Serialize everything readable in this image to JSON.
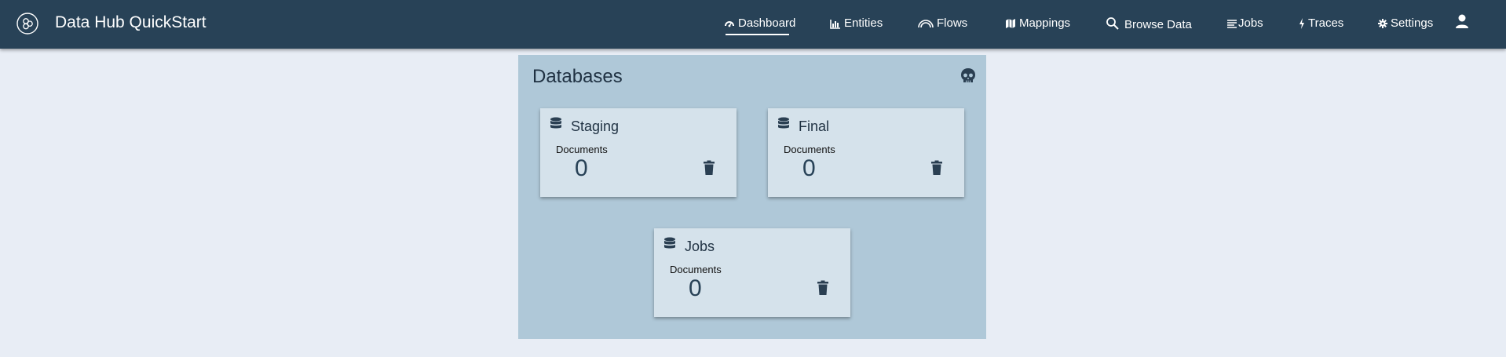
{
  "app": {
    "title": "Data Hub QuickStart"
  },
  "nav": {
    "items": [
      {
        "label": "Dashboard",
        "icon": "dashboard-icon"
      },
      {
        "label": "Entities",
        "icon": "entities-icon"
      },
      {
        "label": "Flows",
        "icon": "flows-icon"
      },
      {
        "label": "Mappings",
        "icon": "map-icon"
      },
      {
        "label": "Browse Data",
        "icon": "search-icon"
      },
      {
        "label": "Jobs",
        "icon": "jobs-icon"
      },
      {
        "label": "Traces",
        "icon": "bolt-icon"
      },
      {
        "label": "Settings",
        "icon": "gear-icon"
      }
    ],
    "active": "Dashboard"
  },
  "panel": {
    "title": "Databases",
    "cards": [
      {
        "name": "Staging",
        "docs_label": "Documents",
        "count": "0"
      },
      {
        "name": "Final",
        "docs_label": "Documents",
        "count": "0"
      },
      {
        "name": "Jobs",
        "docs_label": "Documents",
        "count": "0"
      }
    ]
  },
  "colors": {
    "topbar": "#284257",
    "page_bg": "#e8edf5",
    "panel_bg": "#afc8d8",
    "card_bg": "#d5e2eb",
    "accent_text": "#284257"
  }
}
